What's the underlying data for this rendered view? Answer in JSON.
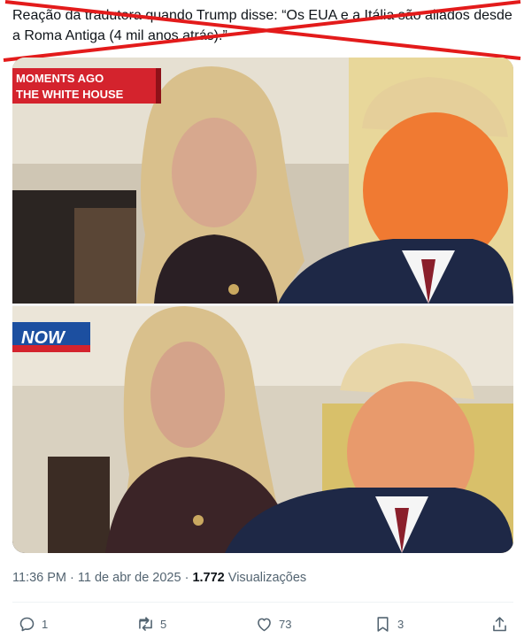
{
  "tweet": {
    "text": "Reação da tradutora quando Trump disse: “Os EUA e a Itália são aliados desde a Roma Antiga (4 mil anos atrás).”"
  },
  "media": {
    "top_banner_line1": "MOMENTS AGO",
    "top_banner_line2": "THE WHITE HOUSE",
    "bottom_logo": "NOW",
    "colors": {
      "banner_red": "#d4232d",
      "suit_navy": "#1e2846",
      "hair_blonde": "#d9c08c"
    }
  },
  "meta": {
    "time": "11:36 PM",
    "dot1": "·",
    "date": "11 de abr de 2025",
    "dot2": "·",
    "views_count": "1.772",
    "views_label": "Visualizações"
  },
  "actions": {
    "reply_count": "1",
    "retweet_count": "5",
    "like_count": "73",
    "bookmark_count": "3"
  },
  "icons": [
    "reply-icon",
    "retweet-icon",
    "like-icon",
    "bookmark-icon",
    "share-icon"
  ]
}
